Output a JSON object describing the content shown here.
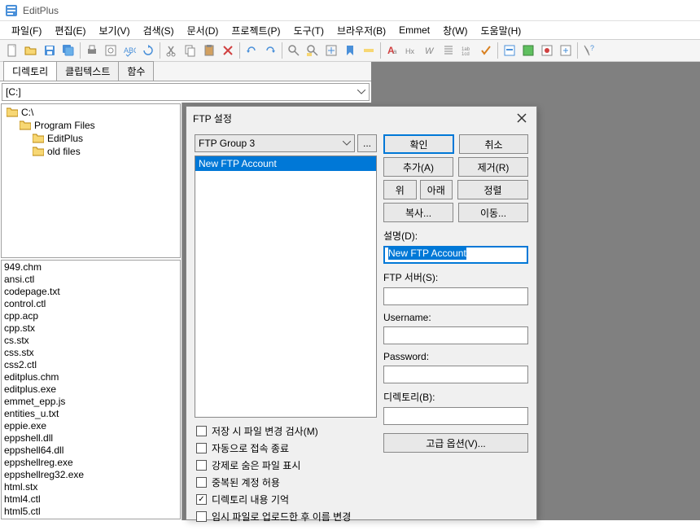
{
  "app": {
    "title": "EditPlus"
  },
  "menu": [
    "파일(F)",
    "편집(E)",
    "보기(V)",
    "검색(S)",
    "문서(D)",
    "프로젝트(P)",
    "도구(T)",
    "브라우저(B)",
    "Emmet",
    "창(W)",
    "도움말(H)"
  ],
  "sideTabs": [
    "디렉토리",
    "클립텍스트",
    "함수"
  ],
  "drive": "[C:]",
  "tree": [
    {
      "label": "C:\\",
      "indent": 0
    },
    {
      "label": "Program Files",
      "indent": 1
    },
    {
      "label": "EditPlus",
      "indent": 2
    },
    {
      "label": "old files",
      "indent": 2
    }
  ],
  "files": [
    "949.chm",
    "ansi.ctl",
    "codepage.txt",
    "control.ctl",
    "cpp.acp",
    "cpp.stx",
    "cs.stx",
    "css.stx",
    "css2.ctl",
    "editplus.chm",
    "editplus.exe",
    "emmet_epp.js",
    "entities_u.txt",
    "eppie.exe",
    "eppshell.dll",
    "eppshell64.dll",
    "eppshellreg.exe",
    "eppshellreg32.exe",
    "html.stx",
    "html4.ctl",
    "html5.ctl"
  ],
  "dialog": {
    "title": "FTP 설정",
    "group": "FTP Group 3",
    "groupBtn": "...",
    "listItems": [
      "New FTP Account"
    ],
    "ok": "확인",
    "cancel": "취소",
    "add": "추가(A)",
    "remove": "제거(R)",
    "up": "위",
    "down": "아래",
    "sort": "정렬",
    "copy": "복사...",
    "move": "이동...",
    "descLabel": "설명(D):",
    "descValue": "New FTP Account",
    "serverLabel": "FTP 서버(S):",
    "serverValue": "",
    "userLabel": "Username:",
    "userValue": "",
    "passLabel": "Password:",
    "passValue": "",
    "dirLabel": "디렉토리(B):",
    "dirValue": "",
    "advanced": "고급 옵션(V)...",
    "checks": [
      {
        "label": "저장 시 파일 변경 검사(M)",
        "checked": false
      },
      {
        "label": "자동으로 접속 종료",
        "checked": false
      },
      {
        "label": "강제로 숨은 파일 표시",
        "checked": false
      },
      {
        "label": "중복된 계정 허용",
        "checked": false
      },
      {
        "label": "디렉토리 내용 기억",
        "checked": true
      },
      {
        "label": "임시 파일로 업로드한 후 이름 변경",
        "checked": false
      }
    ]
  }
}
